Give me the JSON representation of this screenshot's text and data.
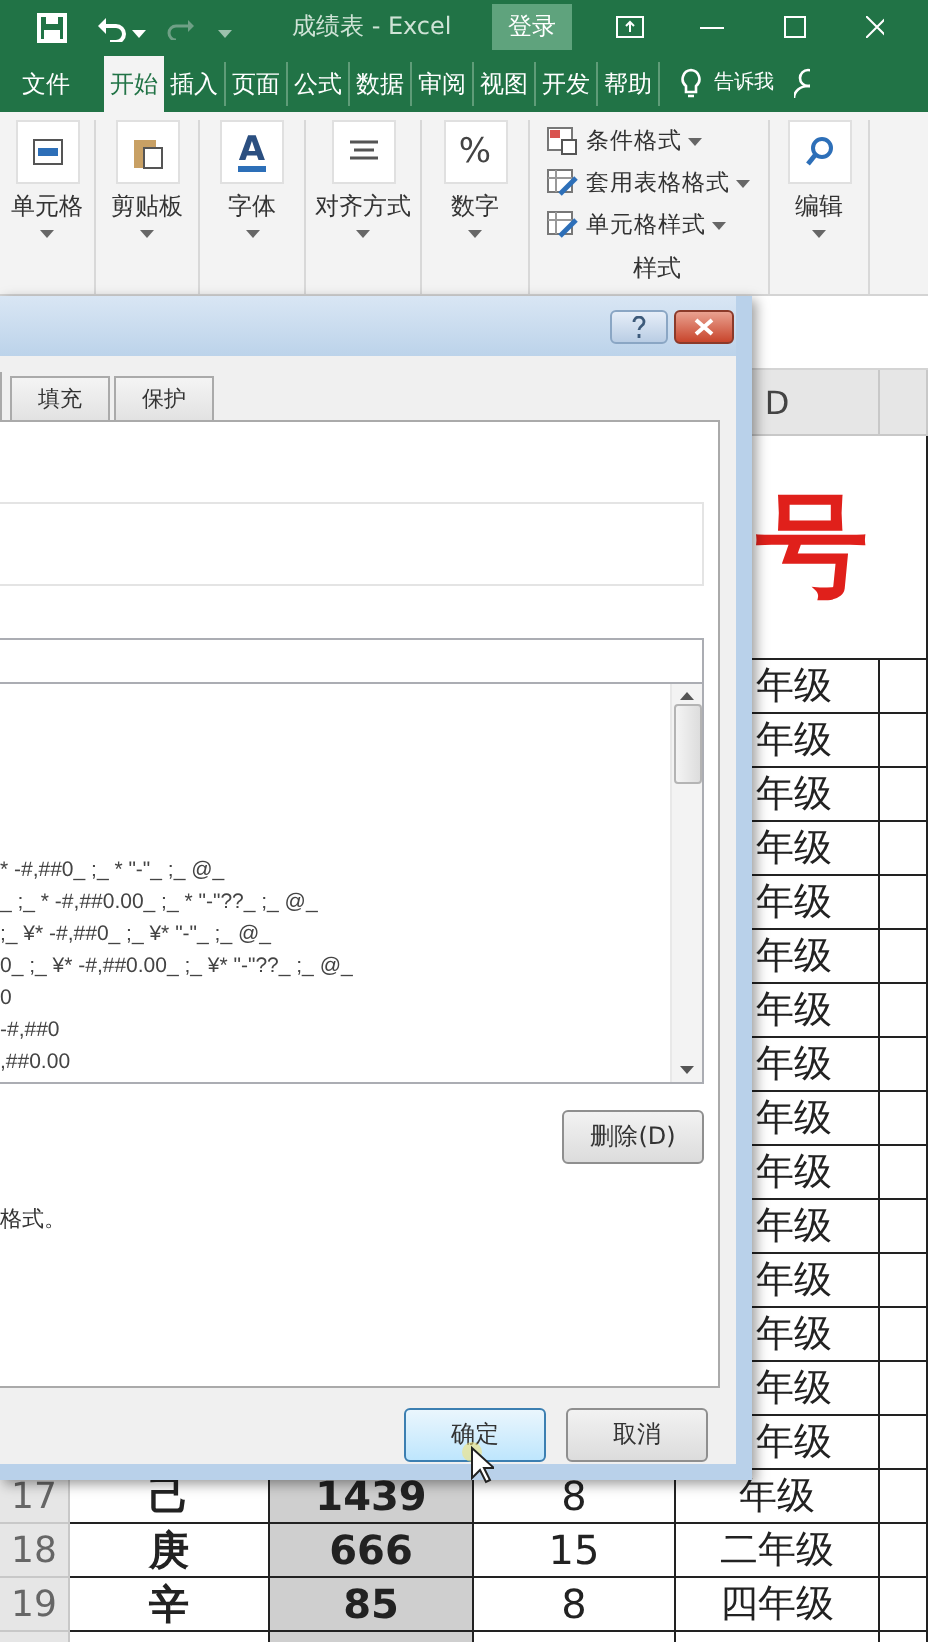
{
  "titlebar": {
    "title": "成绩表 - Excel",
    "login": "登录"
  },
  "tabs": [
    {
      "label": "文件",
      "selected": false
    },
    {
      "label": "开始",
      "selected": true
    },
    {
      "label": "插入",
      "selected": false
    },
    {
      "label": "页面",
      "selected": false
    },
    {
      "label": "公式",
      "selected": false
    },
    {
      "label": "数据",
      "selected": false
    },
    {
      "label": "审阅",
      "selected": false
    },
    {
      "label": "视图",
      "selected": false
    },
    {
      "label": "开发",
      "selected": false
    },
    {
      "label": "帮助",
      "selected": false
    }
  ],
  "tell_me": "告诉我",
  "ribbon": {
    "groups": [
      {
        "kind": "large",
        "label": "单元格"
      },
      {
        "kind": "large",
        "label": "剪贴板"
      },
      {
        "kind": "large",
        "glyph": "A",
        "label": "字体"
      },
      {
        "kind": "large",
        "label": "对齐方式"
      },
      {
        "kind": "large",
        "glyph": "%",
        "label": "数字"
      },
      {
        "kind": "list",
        "label": "样式",
        "items": [
          {
            "label": "条件格式"
          },
          {
            "label": "套用表格格式"
          },
          {
            "label": "单元格样式"
          }
        ]
      },
      {
        "kind": "large",
        "label": "编辑"
      }
    ]
  },
  "dialog": {
    "tabs": [
      {
        "label": "填充",
        "selected": false
      },
      {
        "label": "保护",
        "selected": false
      }
    ],
    "format_lines": [
      "* -#,##0_ ;_ * \"-\"_ ;_ @_",
      "_ ;_ * -#,##0.00_ ;_ * \"-\"??_ ;_ @_",
      ";_ ¥* -#,##0_ ;_ ¥* \"-\"_ ;_ @_",
      "0_ ;_ ¥* -#,##0.00_ ;_ ¥* \"-\"??_ ;_ @_",
      "0",
      "-#,##0",
      ",##0.00"
    ],
    "delete_button": "删除(D)",
    "note": "格式。",
    "ok": "确定",
    "cancel": "取消"
  },
  "sheet": {
    "column_header": "D",
    "title": "号",
    "rows": [
      {
        "grade": "年级"
      },
      {
        "grade": "年级"
      },
      {
        "grade": "年级"
      },
      {
        "grade": "年级"
      },
      {
        "grade": "年级"
      },
      {
        "grade": "年级"
      },
      {
        "grade": "年级"
      },
      {
        "grade": "年级"
      },
      {
        "grade": "年级"
      },
      {
        "grade": "年级"
      },
      {
        "grade": "年级"
      },
      {
        "grade": "年级"
      },
      {
        "grade": "年级"
      },
      {
        "grade": "年级"
      },
      {
        "grade": "年级"
      },
      {
        "number": "17",
        "name": "己",
        "score": "1439",
        "count": "8",
        "grade": "年级"
      },
      {
        "number": "18",
        "name": "庚",
        "score": "666",
        "count": "15",
        "grade": "二年级"
      },
      {
        "number": "19",
        "name": "辛",
        "score": "85",
        "count": "8",
        "grade": "四年级"
      }
    ]
  }
}
